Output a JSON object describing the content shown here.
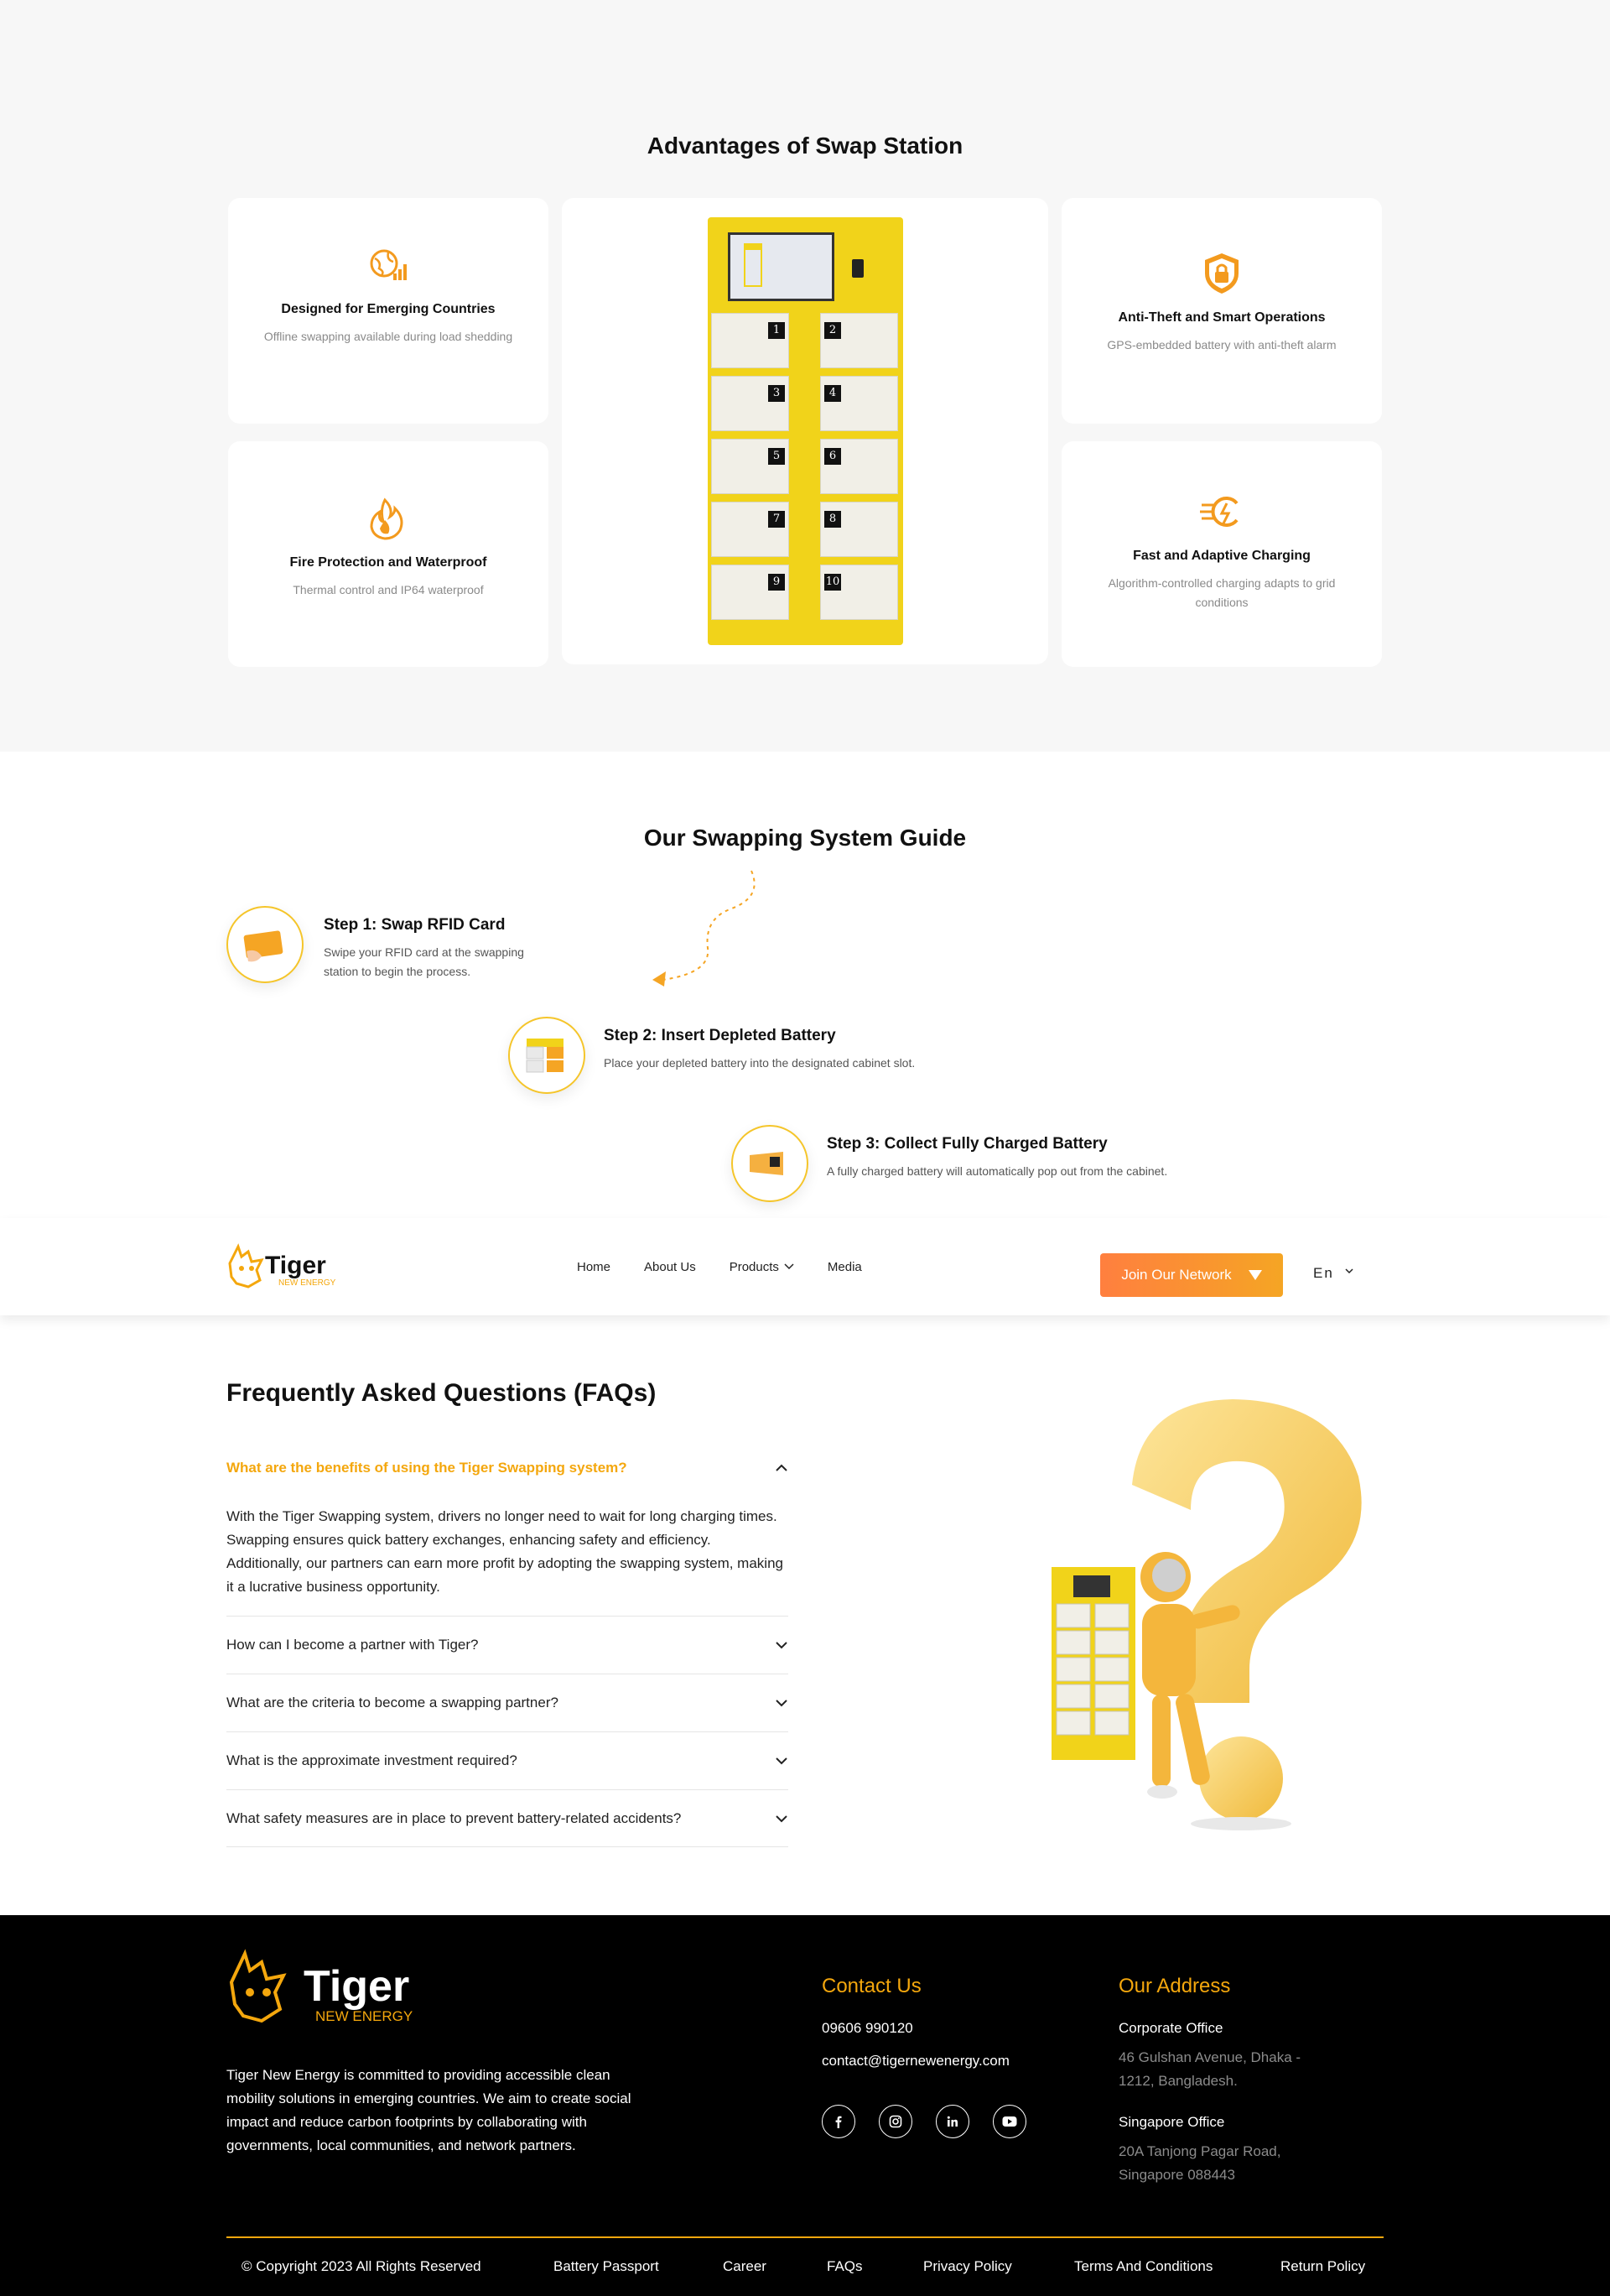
{
  "advantages": {
    "title": "Advantages of Swap Station",
    "cards": [
      {
        "title": "Designed for Emerging Countries",
        "desc": "Offline swapping available during load shedding",
        "icon": "globe-signal-icon"
      },
      {
        "title": "Fire Protection and Waterproof",
        "desc": "Thermal control and IP64 waterproof",
        "icon": "fire-shield-icon"
      },
      {
        "title": "Anti-Theft and Smart Operations",
        "desc": "GPS-embedded battery with anti-theft alarm",
        "icon": "lock-shield-icon"
      },
      {
        "title": "Fast and Adaptive Charging",
        "desc": "Algorithm-controlled charging adapts to grid conditions",
        "icon": "fast-charge-icon"
      }
    ],
    "locker_slots": [
      "1",
      "2",
      "3",
      "4",
      "5",
      "6",
      "7",
      "8",
      "9",
      "10"
    ]
  },
  "guide": {
    "title": "Our Swapping System Guide",
    "steps": [
      {
        "title": "Step 1: Swap RFID Card",
        "desc": "Swipe your RFID card at the swapping station to begin the process."
      },
      {
        "title": "Step 2: Insert Depleted Battery",
        "desc": "Place your depleted battery into the designated cabinet slot."
      },
      {
        "title": "Step 3: Collect Fully Charged Battery",
        "desc": "A fully charged battery will automatically pop out from the cabinet."
      }
    ]
  },
  "nav": {
    "brand": "Tiger",
    "brand_sub": "NEW ENERGY",
    "links": [
      "Home",
      "About Us",
      "Products",
      "Media"
    ],
    "join_label": "Join Our Network",
    "lang": "En"
  },
  "faq": {
    "title": "Frequently Asked Questions (FAQs)",
    "items": [
      {
        "q": "What are the benefits of using the Tiger Swapping system?",
        "a": "With the Tiger Swapping system, drivers no longer need to wait for long charging times. Swapping ensures quick battery exchanges, enhancing safety and efficiency. Additionally, our partners can earn more profit by adopting the swapping system, making it a lucrative business opportunity."
      },
      {
        "q": "How can I become a partner with Tiger?"
      },
      {
        "q": "What are the criteria to become a swapping partner?"
      },
      {
        "q": "What is the approximate investment required?"
      },
      {
        "q": "What safety measures are in place to prevent battery-related accidents?"
      }
    ]
  },
  "footer": {
    "brand": "Tiger",
    "brand_sub": "NEW ENERGY",
    "about": "Tiger New Energy is committed to providing accessible clean mobility solutions in emerging countries. We aim to create social impact and reduce carbon footprints by collaborating with governments, local communities, and network partners.",
    "contact_title": "Contact Us",
    "phone": "09606 990120",
    "email": "contact@tigernewenergy.com",
    "social": [
      "facebook-icon",
      "instagram-icon",
      "linkedin-icon",
      "youtube-icon"
    ],
    "address_title": "Our Address",
    "corporate_label": "Corporate Office",
    "corporate_addr": "46 Gulshan Avenue, Dhaka - 1212, Bangladesh.",
    "singapore_label": "Singapore Office",
    "singapore_addr": "20A Tanjong Pagar Road, Singapore 088443",
    "bottom_links": [
      "© Copyright 2023 All Rights Reserved",
      "Battery Passport",
      "Career",
      "FAQs",
      "Privacy Policy",
      "Terms And Conditions",
      "Return Policy"
    ]
  },
  "colors": {
    "accent": "#f4a70d",
    "orange": "#ff7f3f",
    "locker_yellow": "#f1d31a"
  }
}
